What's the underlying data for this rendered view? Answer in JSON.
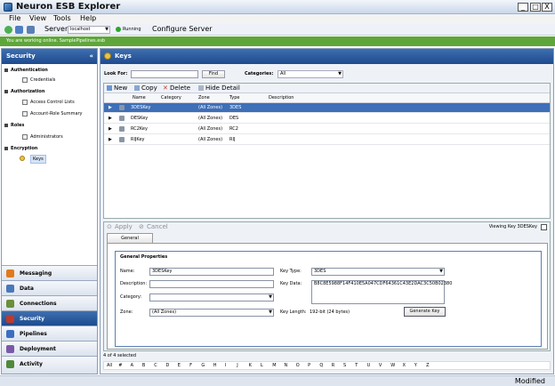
{
  "window": {
    "title": "Neuron ESB Explorer",
    "min": "_",
    "max": "□",
    "close": "X"
  },
  "menu": [
    "File",
    "View",
    "Tools",
    "Help"
  ],
  "toolbar": {
    "server_label": "Server",
    "server_value": "localhost",
    "status": "Running",
    "configure_label": "Configure Server"
  },
  "online_message": "You are working online. SamplePipelines.esb",
  "sidebar": {
    "title": "Security",
    "tree": [
      {
        "group": "Authentication",
        "items": [
          "Credentials"
        ]
      },
      {
        "group": "Authorization",
        "items": [
          "Access Control Lists",
          "Account-Role Summary"
        ]
      },
      {
        "group": "Roles",
        "items": [
          "Administrators"
        ]
      },
      {
        "group": "Encryption",
        "items": [
          "Keys"
        ]
      }
    ],
    "nav": [
      "Messaging",
      "Data",
      "Connections",
      "Security",
      "Pipelines",
      "Deployment",
      "Activity"
    ]
  },
  "main": {
    "title": "Keys",
    "search": {
      "look_for_label": "Look For:",
      "look_for_value": "",
      "find_label": "Find",
      "categories_label": "Categories:",
      "categories_value": "All"
    },
    "grid_toolbar": {
      "new": "New",
      "copy": "Copy",
      "delete": "Delete",
      "hide_detail": "Hide Detail"
    },
    "columns": [
      "Name",
      "Category",
      "Zone",
      "Type",
      "Description"
    ],
    "rows": [
      {
        "name": "3DESKey",
        "category": "",
        "zone": "(All Zones)",
        "type": "3DES",
        "description": ""
      },
      {
        "name": "DESKey",
        "category": "",
        "zone": "(All Zones)",
        "type": "DES",
        "description": ""
      },
      {
        "name": "RC2Key",
        "category": "",
        "zone": "(All Zones)",
        "type": "RC2",
        "description": ""
      },
      {
        "name": "RIJKey",
        "category": "",
        "zone": "(All Zones)",
        "type": "RIJ",
        "description": ""
      }
    ],
    "detail": {
      "apply_label": "Apply",
      "cancel_label": "Cancel",
      "viewing": "Viewing Key 3DESKey",
      "tab": "General",
      "group_title": "General Properties",
      "name_label": "Name:",
      "name_value": "3DESKey",
      "description_label": "Description:",
      "description_value": "",
      "category_label": "Category:",
      "category_value": "",
      "zone_label": "Zone:",
      "zone_value": "(All Zones)",
      "key_type_label": "Key Type:",
      "key_type_value": "3DES",
      "key_data_label": "Key Data:",
      "key_data_value": "B8C8E5988F14F410E5A047CDF64361C43E2DAC3C50B02380",
      "key_length_label": "Key Length:",
      "key_length_value": "192-bit (24 bytes)",
      "generate_label": "Generate Key"
    },
    "selection_status": "4 of 4 selected",
    "alphabet": [
      "All",
      "#",
      "A",
      "B",
      "C",
      "D",
      "E",
      "F",
      "G",
      "H",
      "I",
      "J",
      "K",
      "L",
      "M",
      "N",
      "O",
      "P",
      "Q",
      "R",
      "S",
      "T",
      "U",
      "V",
      "W",
      "X",
      "Y",
      "Z"
    ]
  },
  "status_bar": {
    "text": "Modified"
  },
  "colors": {
    "header_blue": "#1d4a8e",
    "online_green": "#5fa63a",
    "selection_blue": "#3e6fb7"
  }
}
